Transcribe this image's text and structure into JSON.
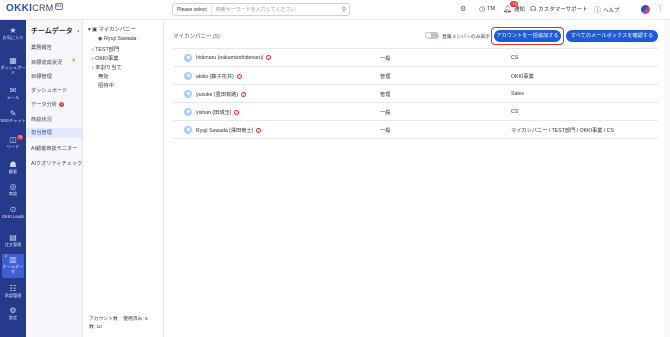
{
  "topbar": {
    "logo": "OKKI",
    "logo_suffix": "CRM",
    "logo_badge": "AI",
    "search_select": "Please select",
    "search_placeholder": "検索キーワードを入力してください",
    "user_initials": "TM",
    "notice_label": "通知",
    "notice_count": "13",
    "support_label": "カスタマーサポート",
    "help_label": "ヘルプ"
  },
  "leftnav": [
    {
      "icon": "star-icon",
      "label": "お気に入り"
    },
    {
      "icon": "dashboard-icon",
      "label": "ダッシュボード"
    },
    {
      "icon": "mail-icon",
      "label": "メール"
    },
    {
      "icon": "chat-icon",
      "label": "SNSチャット"
    },
    {
      "icon": "lead-icon",
      "label": "リード",
      "badge": "78"
    },
    {
      "icon": "customer-icon",
      "label": "顧客"
    },
    {
      "icon": "deal-icon",
      "label": "商談"
    },
    {
      "icon": "okki-leads-icon",
      "label": "OKKI Leads"
    },
    {
      "icon": "order-icon",
      "label": "注文管理"
    },
    {
      "icon": "team-data-icon",
      "label": "チームデータ",
      "badge": "2"
    },
    {
      "icon": "approval-icon",
      "label": "承認管理"
    },
    {
      "icon": "settings-icon",
      "label": "設定"
    }
  ],
  "sidebar": {
    "title": "チームデータ",
    "items": [
      {
        "label": "業務報告"
      },
      {
        "label": "目標達成状況"
      },
      {
        "label": "目標管理"
      },
      {
        "label": "ダッシュボード"
      },
      {
        "label": "データ分析",
        "badge": "1"
      },
      {
        "label": "商談状況"
      },
      {
        "label": "担当管理"
      },
      {
        "label": "AI顧客商談モニター"
      },
      {
        "label": "AIクオリティチェック"
      }
    ]
  },
  "tree": {
    "root": "マイカンパニー",
    "items": [
      "Ryuji Sawada",
      "TEST部門",
      "OKKI事業",
      "未割り当て",
      "無効",
      "招待中"
    ],
    "footer": [
      "アカウント数",
      "使用済み: 6",
      "数: 10"
    ]
  },
  "main": {
    "title": "マイカンパニー (5)",
    "toggle_label": "直属メンバーのみ表示",
    "btn_reassign": "アカウントを一括追加する",
    "btn_mailbox": "すべてのメールボックスを確認する",
    "rows": [
      {
        "name": "hidenaru (nakamizohidenaru)",
        "role": "一般",
        "dept": "CS"
      },
      {
        "name": "akiko (藤子花共)",
        "role": "管理",
        "dept": "OKKI事業"
      },
      {
        "name": "yusuke (豊田有路)",
        "role": "管理",
        "dept": "Sales"
      },
      {
        "name": "yishan (田城玉)",
        "role": "一般",
        "dept": "CS"
      },
      {
        "name": "Ryuji Sawada (澤田竜士)",
        "role": "一般",
        "dept": "マイカンパニー / TEST部門 / OKKI事業 / CS"
      }
    ]
  }
}
